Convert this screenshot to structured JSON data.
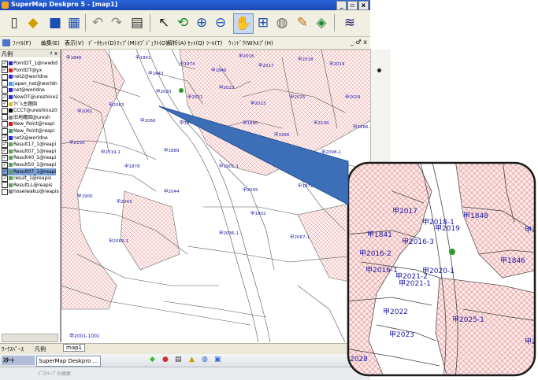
{
  "window": {
    "title": "SuperMap Deskpro 5 - [map1]",
    "controls": [
      "_",
      "▫",
      "x"
    ]
  },
  "menubar": {
    "items": [
      "ﾌｧｲﾙ(F)",
      "編集(E)",
      "表示(V)",
      "ﾃﾞｰﾀｾｯﾄ(D)",
      "ﾏｯﾌﾟ(M)",
      "ｵﾌﾞｼﾞｪｸﾄ(O)",
      "解析(A)",
      "ｾｯﾄ(Q)",
      "ﾂｰﾙ(T)",
      "ｳｨﾝﾄﾞｳ(W)",
      "ﾍﾙﾌﾟ(H)"
    ],
    "child_controls": "_ ♂ x"
  },
  "toolbar": {
    "icons": [
      "new-document-icon",
      "open-icon",
      "save-icon",
      "copy-icon",
      "undo-icon",
      "redo-icon",
      "print-icon",
      "select-arrow-icon",
      "refresh-icon",
      "zoom-in-icon",
      "zoom-out-icon",
      "pan-hand-icon",
      "full-extent-icon",
      "layer-icon",
      "measure-icon",
      "pen-icon",
      "style-icon",
      "stack-icon"
    ]
  },
  "legend_panel": {
    "header_label": "凡例",
    "header_close": "♯ x",
    "layers": [
      {
        "label": "PointDT_1@newbd",
        "checked": true,
        "color": "#2a2ad0"
      },
      {
        "label": "PointDT@yx",
        "checked": true,
        "color": "#d02020"
      },
      {
        "label": "net2@worldne",
        "checked": false,
        "color": "#2a2ad0"
      },
      {
        "label": "japan_net@worldn",
        "checked": false,
        "color": "#40a0ff"
      },
      {
        "label": "net@worldne",
        "checked": false,
        "color": "#2a2ad0"
      },
      {
        "label": "NewDT@ureshino2",
        "checked": true,
        "color": "#2a2ad0"
      },
      {
        "label": "ﾗﾍﾞﾙ主題図",
        "checked": true,
        "color": "#d8c020"
      },
      {
        "label": "CCCT@ureshino20",
        "checked": false,
        "color": "#000000"
      },
      {
        "label": "旧地籍図@uresh",
        "checked": false,
        "color": "#888888"
      },
      {
        "label": "New_Point@reapi",
        "checked": false,
        "color": "#d02020"
      },
      {
        "label": "New_Point@reapi",
        "checked": false,
        "color": "#40a060"
      },
      {
        "label": "net2@worldne",
        "checked": true,
        "color": "#2a2ad0"
      },
      {
        "label": "Result17_1@reapi",
        "checked": true,
        "color": "#60a060"
      },
      {
        "label": "Result07_1@reapi",
        "checked": true,
        "color": "#60a060"
      },
      {
        "label": "Result40_1@reapi",
        "checked": true,
        "color": "#60a060"
      },
      {
        "label": "Result50_1@reapi",
        "checked": true,
        "color": "#60a060"
      },
      {
        "label": "Result07_1@reapi",
        "checked": true,
        "color": "#60a060"
      },
      {
        "label": "result_1@reapis",
        "checked": true,
        "color": "#60a060"
      },
      {
        "label": "ResultLL@reapis",
        "checked": false,
        "color": "#60a060"
      },
      {
        "label": "hoseiwakui@reapis",
        "checked": false,
        "color": "#888888"
      }
    ]
  },
  "bottom_tabs": [
    "ﾜｰｸｽﾍﾟｰｽ",
    "凡例",
    "map1"
  ],
  "taskbar": {
    "start": "ｽﾀｰﾄ",
    "task": "SuperMap Deskpro ...",
    "search_placeholder": "ﾃﾞｽｸﾄｯﾌﾟの検索"
  },
  "map": {
    "parcel_labels": [
      "甲1846",
      "甲1841",
      "甲1843",
      "甲1974",
      "甲1846",
      "甲2016",
      "甲2017",
      "甲2018",
      "甲2019",
      "甲2020",
      "甲2021",
      "甲2022",
      "甲2023",
      "甲2025",
      "甲2029",
      "甲2061",
      "甲2063",
      "甲2066",
      "甲1875",
      "甲1880",
      "甲1956",
      "甲2100",
      "甲2066-1",
      "甲2150",
      "甲2019-1",
      "甲1889",
      "甲1895",
      "甲2098-1",
      "甲1878",
      "甲1901-1",
      "甲1900",
      "甲2043",
      "甲2044",
      "甲2045",
      "甲1871",
      "甲2039-1",
      "甲1902",
      "甲2036-1",
      "甲2067-1",
      "甲2082-1"
    ],
    "bottom_left_label": "甲2001-1001"
  },
  "callout": {
    "labels": [
      "甲2017",
      "甲2018-1",
      "甲2019",
      "甲1848",
      "甲1841",
      "甲2016-3",
      "甲2016-2",
      "甲2016-1",
      "甲2021-2",
      "甲2020-1",
      "甲2021-1",
      "甲2022",
      "甲2023",
      "甲2025-1",
      "甲1846",
      "甲184",
      "甲207",
      "2028"
    ]
  }
}
